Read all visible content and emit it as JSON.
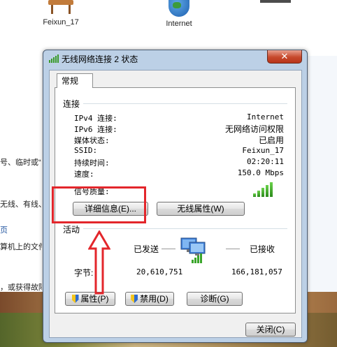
{
  "desktop": {
    "icons": [
      {
        "label": "Feixun_17"
      },
      {
        "label": "Internet"
      }
    ]
  },
  "background_text": {
    "frag1": "号、临时或“",
    "frag2": "无线、有线、",
    "frag3": "页",
    "frag4": "算机上的文件",
    "frag5": "，或获得故障"
  },
  "dialog": {
    "title": "无线网络连接 2 状态",
    "close_symbol": "✕",
    "tab_label": "常规",
    "connection_group": "连接",
    "rows": [
      {
        "label": "IPv4 连接:",
        "value": "Internet"
      },
      {
        "label": "IPv6 连接:",
        "value": "无网络访问权限"
      },
      {
        "label": "媒体状态:",
        "value": "已启用"
      },
      {
        "label": "SSID:",
        "value": "Feixun_17"
      },
      {
        "label": "持续时间:",
        "value": "02:20:11"
      },
      {
        "label": "速度:",
        "value": "150.0 Mbps"
      }
    ],
    "signal_label": "信号质量:",
    "signal_level_bars": 5,
    "details_button": "详细信息(E)...",
    "wireless_props_button": "无线属性(W)",
    "activity_group": "活动",
    "sent_label": "已发送",
    "received_label": "已接收",
    "bytes_label": "字节:",
    "bytes_sent": "20,610,751",
    "bytes_received": "166,181,057",
    "properties_button": "属性(P)",
    "disable_button": "禁用(D)",
    "diagnose_button": "诊断(G)",
    "close_button": "关闭(C)"
  },
  "colors": {
    "annotation": "#e3262b",
    "signal_green": "#3aa52a",
    "title_bar": "#bcd0e6"
  }
}
